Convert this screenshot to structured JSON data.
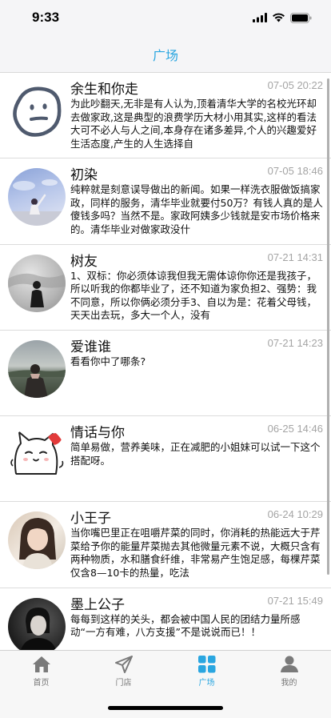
{
  "status_bar": {
    "time": "9:33"
  },
  "nav": {
    "title": "广场"
  },
  "posts": [
    {
      "name": "余生和你走",
      "time": "07-05 20:22",
      "content": "为此吵翻天,无非是有人认为,顶着清华大学的名校光环却去做家政,这是典型的浪费学历大材小用其实,这样的看法大可不必人与人之间,本身存在诸多差异,个人的兴趣爱好生活态度,产生的人生选择自",
      "avatar": "doodle-face"
    },
    {
      "name": "初染",
      "time": "07-05 18:46",
      "content": "纯粹就是刻意误导做出的新闻。如果一样洗衣服做饭搞家政，同样的服务，清华毕业就要付50万？有钱人真的是人傻钱多吗？当然不是。家政阿姨多少钱就是安市场价格来的。清华毕业对做家政没什",
      "avatar": "sky-photo"
    },
    {
      "name": "树友",
      "time": "07-21 14:31",
      "content": "1、双标：你必须体谅我但我无需体谅你你还是我孩子，所以听我的你都毕业了，还不知道为家负担2、强势：我不同意，所以你俩必须分手3、自以为是：花着父母钱，天天出去玩，多大一个人，没有",
      "avatar": "bw-photo"
    },
    {
      "name": "爱谁谁",
      "time": "07-21 14:23",
      "content": "看看你中了哪条?",
      "avatar": "lake-photo"
    },
    {
      "name": "情话与你",
      "time": "06-25 14:46",
      "content": "简单易做，营养美味，正在减肥的小姐妹可以试一下这个搭配呀。",
      "avatar": "cat-cartoon"
    },
    {
      "name": "小王子",
      "time": "06-24 10:29",
      "content": "当你嘴巴里正在咀嚼芹菜的同时，你消耗的热能远大于芹菜给予你的能量芹菜抛去其他微量元素不说，大概只含有两种物质，水和膳食纤维，非常易产生饱足感，每棵芹菜仅含8—10卡的热量，吃法",
      "avatar": "portrait-photo"
    },
    {
      "name": "墨上公子",
      "time": "07-21 15:49",
      "content": "每每到这样的关头，都会被中国人民的团结力量所感动“一方有难，八方支援”不是说说而已！！",
      "avatar": "dark-portrait"
    }
  ],
  "tabs": [
    {
      "label": "首页",
      "icon": "home-icon"
    },
    {
      "label": "门店",
      "icon": "send-icon"
    },
    {
      "label": "广场",
      "icon": "grid-icon",
      "active": true
    },
    {
      "label": "我的",
      "icon": "person-icon"
    }
  ],
  "colors": {
    "accent": "#2aa6e0",
    "bar_bg": "#f5f5f7",
    "divider": "#dcdcdc",
    "time_text": "#a4a4a4"
  }
}
